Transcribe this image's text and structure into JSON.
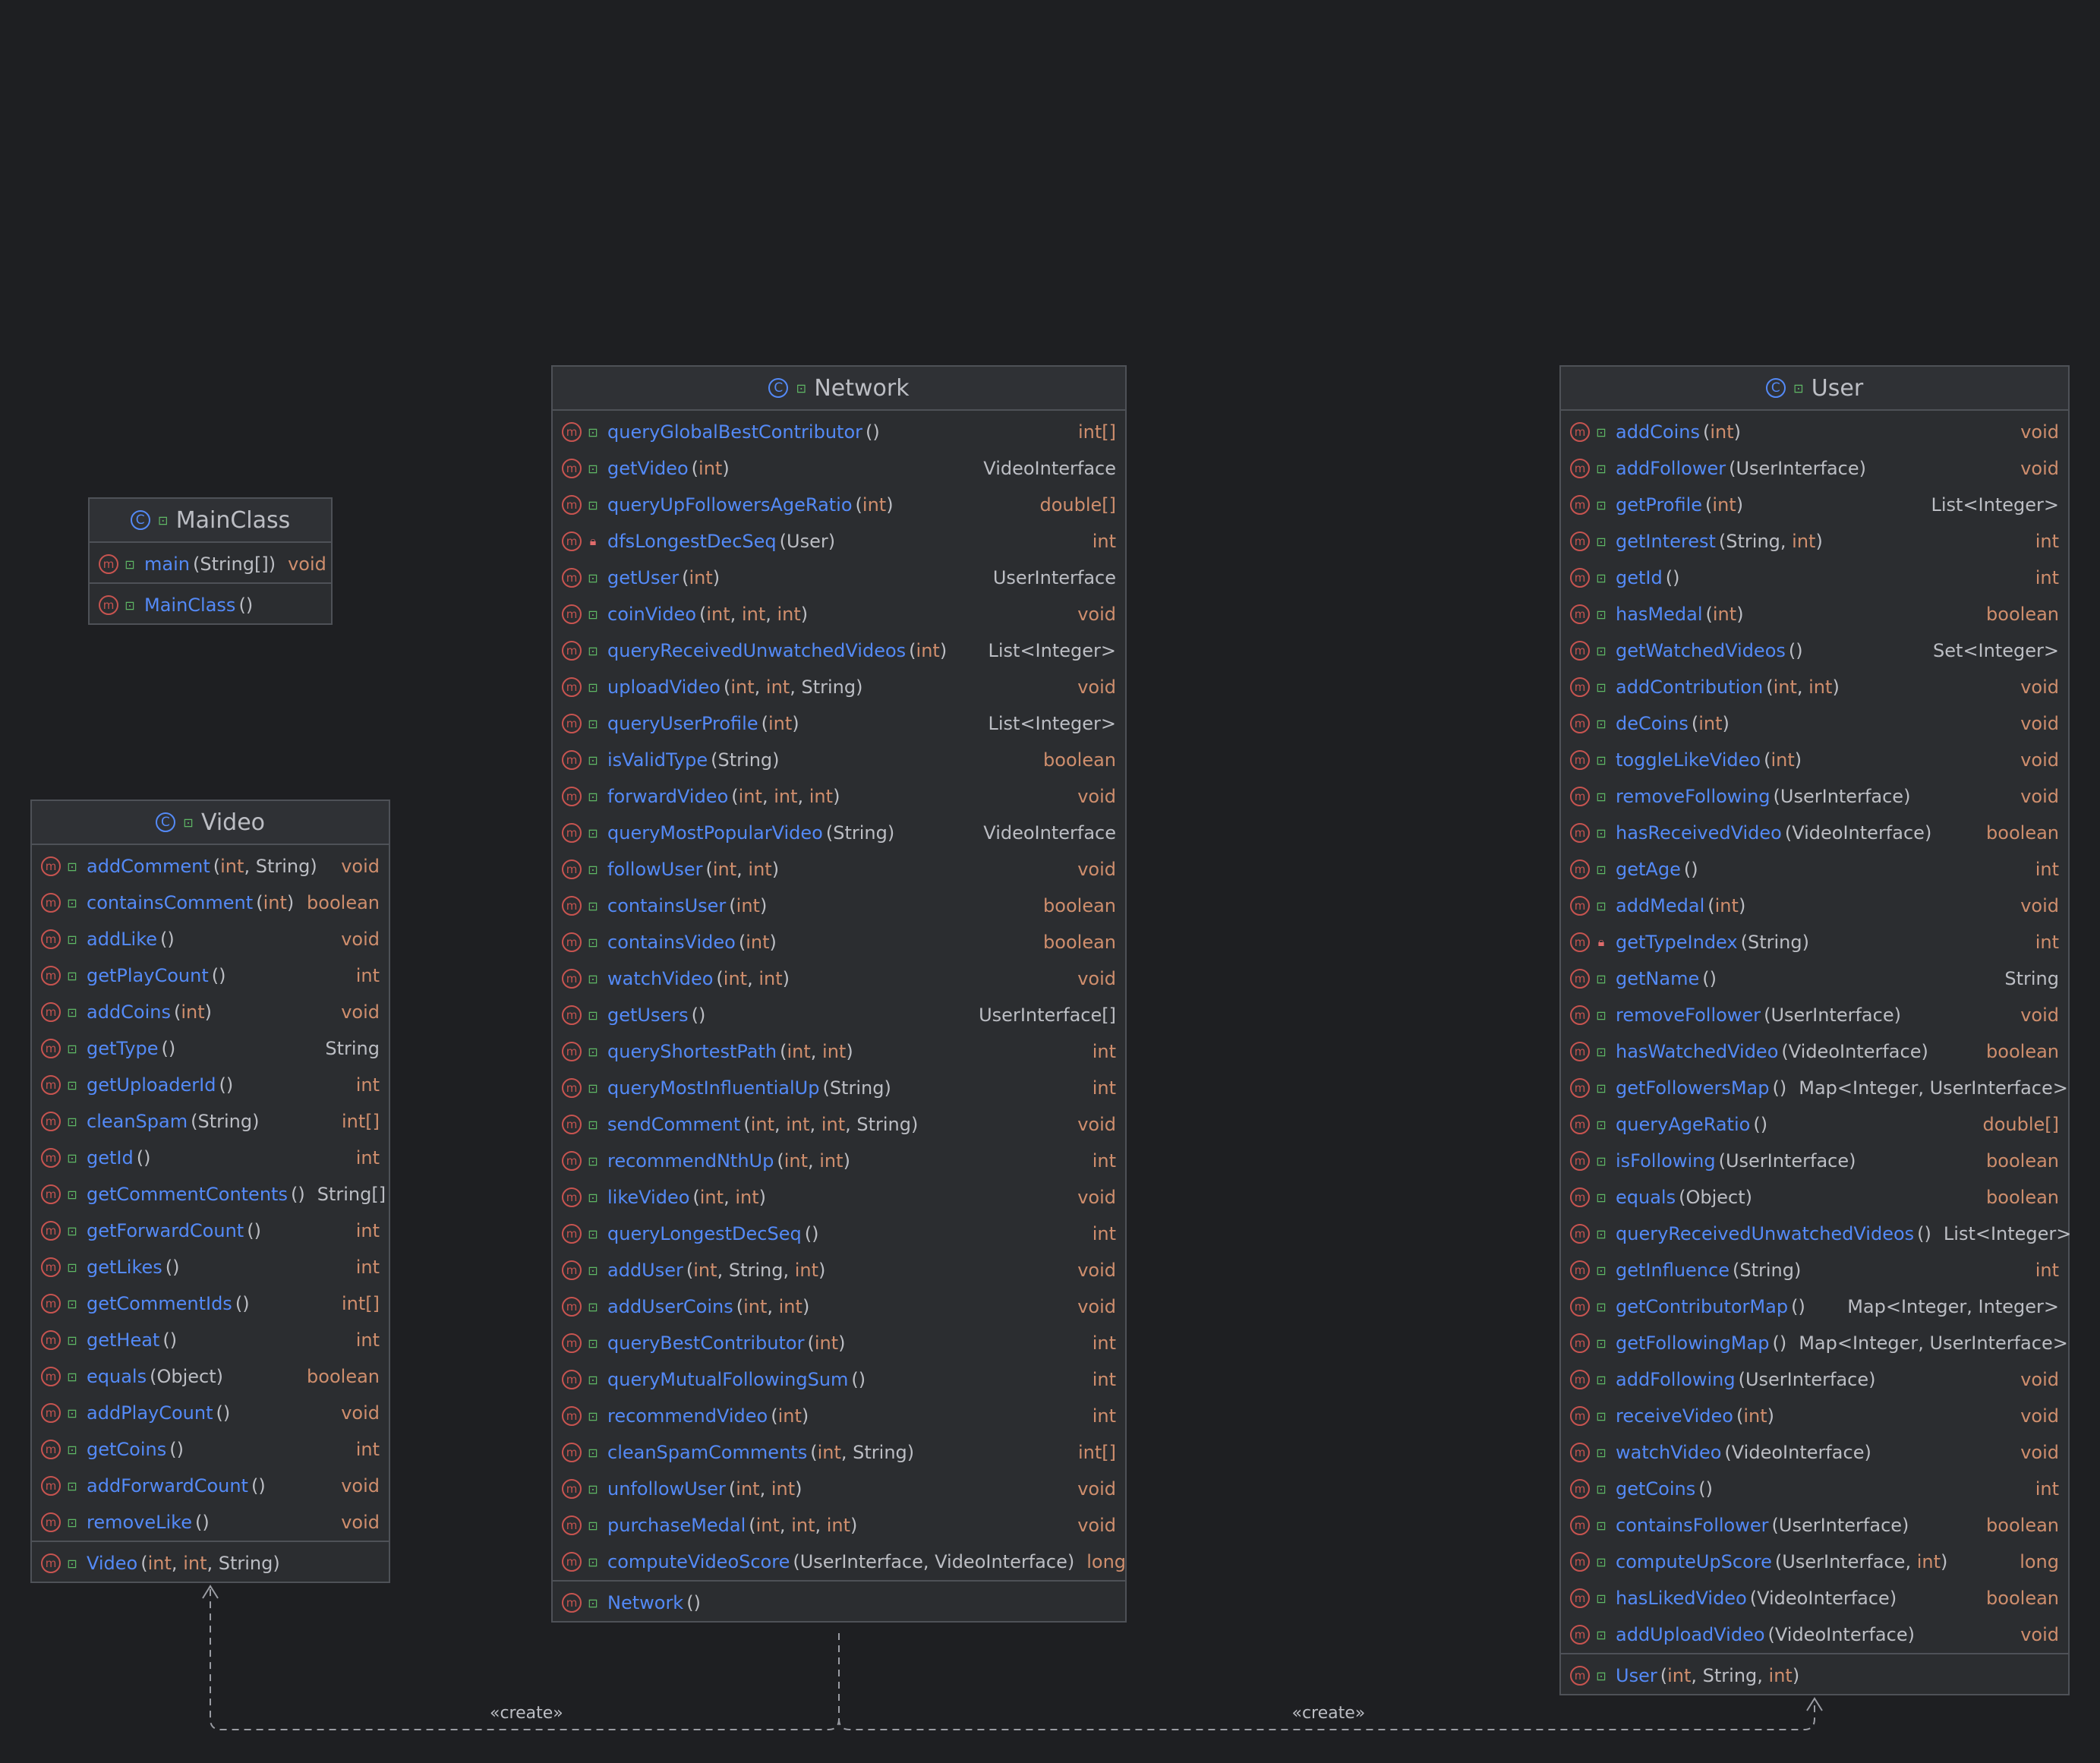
{
  "classes": [
    {
      "id": "mainclass",
      "name": "MainClass",
      "icon": "class-runnable-icon",
      "methods": [
        {
          "name": "main",
          "params": [
            "String[]"
          ],
          "ret": "void",
          "vis": "public"
        }
      ],
      "constructors": [
        {
          "name": "MainClass",
          "params": [],
          "ret": "",
          "vis": "public"
        }
      ]
    },
    {
      "id": "video",
      "name": "Video",
      "icon": "class-icon",
      "methods": [
        {
          "name": "addComment",
          "params": [
            "int",
            "String"
          ],
          "ret": "void",
          "vis": "public"
        },
        {
          "name": "containsComment",
          "params": [
            "int"
          ],
          "ret": "boolean",
          "vis": "public"
        },
        {
          "name": "addLike",
          "params": [],
          "ret": "void",
          "vis": "public"
        },
        {
          "name": "getPlayCount",
          "params": [],
          "ret": "int",
          "vis": "public"
        },
        {
          "name": "addCoins",
          "params": [
            "int"
          ],
          "ret": "void",
          "vis": "public"
        },
        {
          "name": "getType",
          "params": [],
          "ret": "String",
          "vis": "public"
        },
        {
          "name": "getUploaderId",
          "params": [],
          "ret": "int",
          "vis": "public"
        },
        {
          "name": "cleanSpam",
          "params": [
            "String"
          ],
          "ret": "int[]",
          "vis": "public"
        },
        {
          "name": "getId",
          "params": [],
          "ret": "int",
          "vis": "public"
        },
        {
          "name": "getCommentContents",
          "params": [],
          "ret": "String[]",
          "vis": "public"
        },
        {
          "name": "getForwardCount",
          "params": [],
          "ret": "int",
          "vis": "public"
        },
        {
          "name": "getLikes",
          "params": [],
          "ret": "int",
          "vis": "public"
        },
        {
          "name": "getCommentIds",
          "params": [],
          "ret": "int[]",
          "vis": "public"
        },
        {
          "name": "getHeat",
          "params": [],
          "ret": "int",
          "vis": "public"
        },
        {
          "name": "equals",
          "params": [
            "Object"
          ],
          "ret": "boolean",
          "vis": "public"
        },
        {
          "name": "addPlayCount",
          "params": [],
          "ret": "void",
          "vis": "public"
        },
        {
          "name": "getCoins",
          "params": [],
          "ret": "int",
          "vis": "public"
        },
        {
          "name": "addForwardCount",
          "params": [],
          "ret": "void",
          "vis": "public"
        },
        {
          "name": "removeLike",
          "params": [],
          "ret": "void",
          "vis": "public"
        }
      ],
      "constructors": [
        {
          "name": "Video",
          "params": [
            "int",
            "int",
            "String"
          ],
          "ret": "",
          "vis": "public"
        }
      ]
    },
    {
      "id": "network",
      "name": "Network",
      "icon": "class-icon",
      "methods": [
        {
          "name": "queryGlobalBestContributor",
          "params": [],
          "ret": "int[]",
          "vis": "public"
        },
        {
          "name": "getVideo",
          "params": [
            "int"
          ],
          "ret": "VideoInterface",
          "vis": "public"
        },
        {
          "name": "queryUpFollowersAgeRatio",
          "params": [
            "int"
          ],
          "ret": "double[]",
          "vis": "public"
        },
        {
          "name": "dfsLongestDecSeq",
          "params": [
            "User"
          ],
          "ret": "int",
          "vis": "private"
        },
        {
          "name": "getUser",
          "params": [
            "int"
          ],
          "ret": "UserInterface",
          "vis": "public"
        },
        {
          "name": "coinVideo",
          "params": [
            "int",
            "int",
            "int"
          ],
          "ret": "void",
          "vis": "public"
        },
        {
          "name": "queryReceivedUnwatchedVideos",
          "params": [
            "int"
          ],
          "ret": "List<Integer>",
          "vis": "public"
        },
        {
          "name": "uploadVideo",
          "params": [
            "int",
            "int",
            "String"
          ],
          "ret": "void",
          "vis": "public"
        },
        {
          "name": "queryUserProfile",
          "params": [
            "int"
          ],
          "ret": "List<Integer>",
          "vis": "public"
        },
        {
          "name": "isValidType",
          "params": [
            "String"
          ],
          "ret": "boolean",
          "vis": "public"
        },
        {
          "name": "forwardVideo",
          "params": [
            "int",
            "int",
            "int"
          ],
          "ret": "void",
          "vis": "public"
        },
        {
          "name": "queryMostPopularVideo",
          "params": [
            "String"
          ],
          "ret": "VideoInterface",
          "vis": "public"
        },
        {
          "name": "followUser",
          "params": [
            "int",
            "int"
          ],
          "ret": "void",
          "vis": "public"
        },
        {
          "name": "containsUser",
          "params": [
            "int"
          ],
          "ret": "boolean",
          "vis": "public"
        },
        {
          "name": "containsVideo",
          "params": [
            "int"
          ],
          "ret": "boolean",
          "vis": "public"
        },
        {
          "name": "watchVideo",
          "params": [
            "int",
            "int"
          ],
          "ret": "void",
          "vis": "public"
        },
        {
          "name": "getUsers",
          "params": [],
          "ret": "UserInterface[]",
          "vis": "public"
        },
        {
          "name": "queryShortestPath",
          "params": [
            "int",
            "int"
          ],
          "ret": "int",
          "vis": "public"
        },
        {
          "name": "queryMostInfluentialUp",
          "params": [
            "String"
          ],
          "ret": "int",
          "vis": "public"
        },
        {
          "name": "sendComment",
          "params": [
            "int",
            "int",
            "int",
            "String"
          ],
          "ret": "void",
          "vis": "public"
        },
        {
          "name": "recommendNthUp",
          "params": [
            "int",
            "int"
          ],
          "ret": "int",
          "vis": "public"
        },
        {
          "name": "likeVideo",
          "params": [
            "int",
            "int"
          ],
          "ret": "void",
          "vis": "public"
        },
        {
          "name": "queryLongestDecSeq",
          "params": [],
          "ret": "int",
          "vis": "public"
        },
        {
          "name": "addUser",
          "params": [
            "int",
            "String",
            "int"
          ],
          "ret": "void",
          "vis": "public"
        },
        {
          "name": "addUserCoins",
          "params": [
            "int",
            "int"
          ],
          "ret": "void",
          "vis": "public"
        },
        {
          "name": "queryBestContributor",
          "params": [
            "int"
          ],
          "ret": "int",
          "vis": "public"
        },
        {
          "name": "queryMutualFollowingSum",
          "params": [],
          "ret": "int",
          "vis": "public"
        },
        {
          "name": "recommendVideo",
          "params": [
            "int"
          ],
          "ret": "int",
          "vis": "public"
        },
        {
          "name": "cleanSpamComments",
          "params": [
            "int",
            "String"
          ],
          "ret": "int[]",
          "vis": "public"
        },
        {
          "name": "unfollowUser",
          "params": [
            "int",
            "int"
          ],
          "ret": "void",
          "vis": "public"
        },
        {
          "name": "purchaseMedal",
          "params": [
            "int",
            "int",
            "int"
          ],
          "ret": "void",
          "vis": "public"
        },
        {
          "name": "computeVideoScore",
          "params": [
            "UserInterface",
            "VideoInterface"
          ],
          "ret": "long",
          "vis": "public"
        }
      ],
      "constructors": [
        {
          "name": "Network",
          "params": [],
          "ret": "",
          "vis": "public"
        }
      ]
    },
    {
      "id": "user",
      "name": "User",
      "icon": "class-icon",
      "methods": [
        {
          "name": "addCoins",
          "params": [
            "int"
          ],
          "ret": "void",
          "vis": "public"
        },
        {
          "name": "addFollower",
          "params": [
            "UserInterface"
          ],
          "ret": "void",
          "vis": "public"
        },
        {
          "name": "getProfile",
          "params": [
            "int"
          ],
          "ret": "List<Integer>",
          "vis": "public"
        },
        {
          "name": "getInterest",
          "params": [
            "String",
            "int"
          ],
          "ret": "int",
          "vis": "public"
        },
        {
          "name": "getId",
          "params": [],
          "ret": "int",
          "vis": "public"
        },
        {
          "name": "hasMedal",
          "params": [
            "int"
          ],
          "ret": "boolean",
          "vis": "public"
        },
        {
          "name": "getWatchedVideos",
          "params": [],
          "ret": "Set<Integer>",
          "vis": "public"
        },
        {
          "name": "addContribution",
          "params": [
            "int",
            "int"
          ],
          "ret": "void",
          "vis": "public"
        },
        {
          "name": "deCoins",
          "params": [
            "int"
          ],
          "ret": "void",
          "vis": "public"
        },
        {
          "name": "toggleLikeVideo",
          "params": [
            "int"
          ],
          "ret": "void",
          "vis": "public"
        },
        {
          "name": "removeFollowing",
          "params": [
            "UserInterface"
          ],
          "ret": "void",
          "vis": "public"
        },
        {
          "name": "hasReceivedVideo",
          "params": [
            "VideoInterface"
          ],
          "ret": "boolean",
          "vis": "public"
        },
        {
          "name": "getAge",
          "params": [],
          "ret": "int",
          "vis": "public"
        },
        {
          "name": "addMedal",
          "params": [
            "int"
          ],
          "ret": "void",
          "vis": "public"
        },
        {
          "name": "getTypeIndex",
          "params": [
            "String"
          ],
          "ret": "int",
          "vis": "private"
        },
        {
          "name": "getName",
          "params": [],
          "ret": "String",
          "vis": "public"
        },
        {
          "name": "removeFollower",
          "params": [
            "UserInterface"
          ],
          "ret": "void",
          "vis": "public"
        },
        {
          "name": "hasWatchedVideo",
          "params": [
            "VideoInterface"
          ],
          "ret": "boolean",
          "vis": "public"
        },
        {
          "name": "getFollowersMap",
          "params": [],
          "ret": "Map<Integer, UserInterface>",
          "vis": "public"
        },
        {
          "name": "queryAgeRatio",
          "params": [],
          "ret": "double[]",
          "vis": "public"
        },
        {
          "name": "isFollowing",
          "params": [
            "UserInterface"
          ],
          "ret": "boolean",
          "vis": "public"
        },
        {
          "name": "equals",
          "params": [
            "Object"
          ],
          "ret": "boolean",
          "vis": "public"
        },
        {
          "name": "queryReceivedUnwatchedVideos",
          "params": [],
          "ret": "List<Integer>",
          "vis": "public"
        },
        {
          "name": "getInfluence",
          "params": [
            "String"
          ],
          "ret": "int",
          "vis": "public"
        },
        {
          "name": "getContributorMap",
          "params": [],
          "ret": "Map<Integer, Integer>",
          "vis": "public"
        },
        {
          "name": "getFollowingMap",
          "params": [],
          "ret": "Map<Integer, UserInterface>",
          "vis": "public"
        },
        {
          "name": "addFollowing",
          "params": [
            "UserInterface"
          ],
          "ret": "void",
          "vis": "public"
        },
        {
          "name": "receiveVideo",
          "params": [
            "int"
          ],
          "ret": "void",
          "vis": "public"
        },
        {
          "name": "watchVideo",
          "params": [
            "VideoInterface"
          ],
          "ret": "void",
          "vis": "public"
        },
        {
          "name": "getCoins",
          "params": [],
          "ret": "int",
          "vis": "public"
        },
        {
          "name": "containsFollower",
          "params": [
            "UserInterface"
          ],
          "ret": "boolean",
          "vis": "public"
        },
        {
          "name": "computeUpScore",
          "params": [
            "UserInterface",
            "int"
          ],
          "ret": "long",
          "vis": "public"
        },
        {
          "name": "hasLikedVideo",
          "params": [
            "VideoInterface"
          ],
          "ret": "boolean",
          "vis": "public"
        },
        {
          "name": "addUploadVideo",
          "params": [
            "VideoInterface"
          ],
          "ret": "void",
          "vis": "public"
        }
      ],
      "constructors": [
        {
          "name": "User",
          "params": [
            "int",
            "String",
            "int"
          ],
          "ret": "",
          "vis": "public"
        }
      ]
    }
  ],
  "edges": [
    {
      "from": "network",
      "to": "video",
      "label": "«create»",
      "style": "dashed"
    },
    {
      "from": "network",
      "to": "user",
      "label": "«create»",
      "style": "dashed"
    }
  ],
  "colors": {
    "background": "#1e1f22",
    "box": "#2b2d30",
    "border": "#4e5157",
    "method_name": "#548af7",
    "primitive": "#cf8e6d",
    "method_icon": "#c75450",
    "public_icon": "#5fb865",
    "private_icon": "#e06c6c"
  }
}
